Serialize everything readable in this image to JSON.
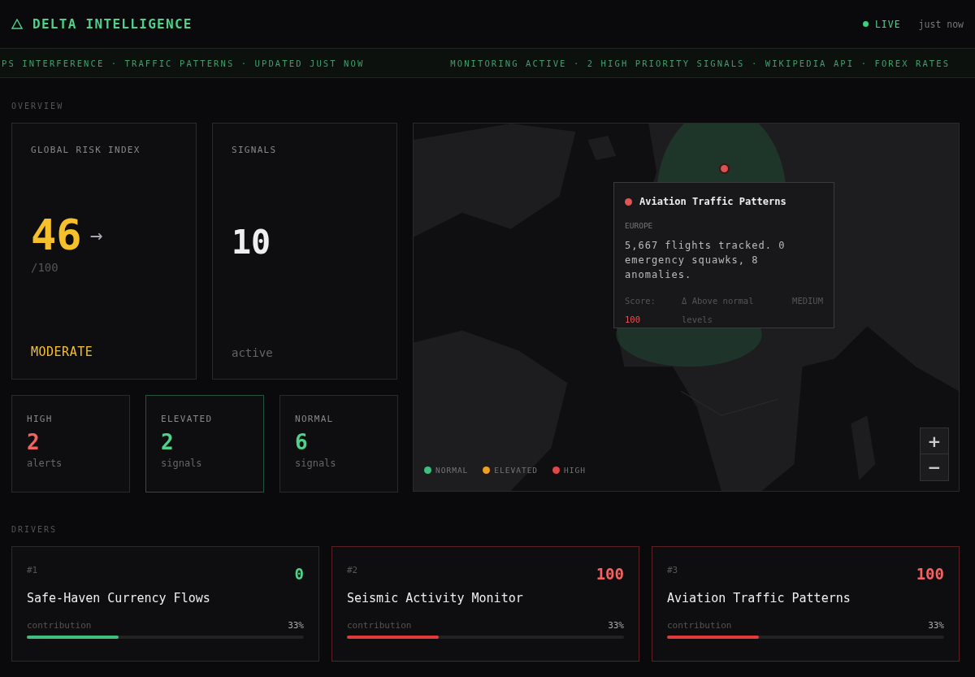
{
  "header": {
    "title": "DELTA INTELLIGENCE",
    "live_label": "LIVE",
    "live": true,
    "updated": "just now"
  },
  "ticker": [
    "PS INTERFERENCE · TRAFFIC PATTERNS · UPDATED JUST NOW",
    "MONITORING ACTIVE · 2 HIGH PRIORITY SIGNALS · WIKIPEDIA API · FOREX RATES"
  ],
  "overview": {
    "label": "OVERVIEW",
    "risk": {
      "label": "GLOBAL RISK INDEX",
      "value": "46",
      "trend": "→",
      "scale": "/100",
      "status": "MODERATE"
    },
    "signals": {
      "label": "SIGNALS",
      "value": "10",
      "caption": "active"
    },
    "counts": [
      {
        "label": "HIGH",
        "value": "2",
        "caption": "alerts",
        "color": "#ef6461",
        "selected": false
      },
      {
        "label": "ELEVATED",
        "value": "2",
        "caption": "signals",
        "color": "#4fd18b",
        "selected": true
      },
      {
        "label": "NORMAL",
        "value": "6",
        "caption": "signals",
        "color": "#4fd18b",
        "selected": false
      }
    ]
  },
  "map": {
    "kind": "picture",
    "tooltip": {
      "title": "Aviation Traffic Patterns",
      "region": "EUROPE",
      "description": "5,667 flights tracked. 0 emergency squawks, 8 anomalies.",
      "score_label": "Score:",
      "score": "100",
      "delta": "Δ Above normal levels",
      "level": "MEDIUM"
    },
    "legend": [
      {
        "label": "NORMAL",
        "color": "#3fbf7f"
      },
      {
        "label": "ELEVATED",
        "color": "#f0a020"
      },
      {
        "label": "HIGH",
        "color": "#e04848"
      }
    ],
    "zoom": [
      "+",
      "−"
    ]
  },
  "drivers": {
    "label": "DRIVERS",
    "items": [
      {
        "rank": "#1",
        "score": "0",
        "title": "Safe-Haven Currency Flows",
        "caption": "contribution",
        "share": "33%",
        "level": 0.33,
        "kind": "normal"
      },
      {
        "rank": "#2",
        "score": "100",
        "title": "Seismic Activity Monitor",
        "caption": "contribution",
        "share": "33%",
        "level": 0.33,
        "kind": "high"
      },
      {
        "rank": "#3",
        "score": "100",
        "title": "Aviation Traffic Patterns",
        "caption": "contribution",
        "share": "33%",
        "level": 0.33,
        "kind": "high"
      }
    ]
  }
}
